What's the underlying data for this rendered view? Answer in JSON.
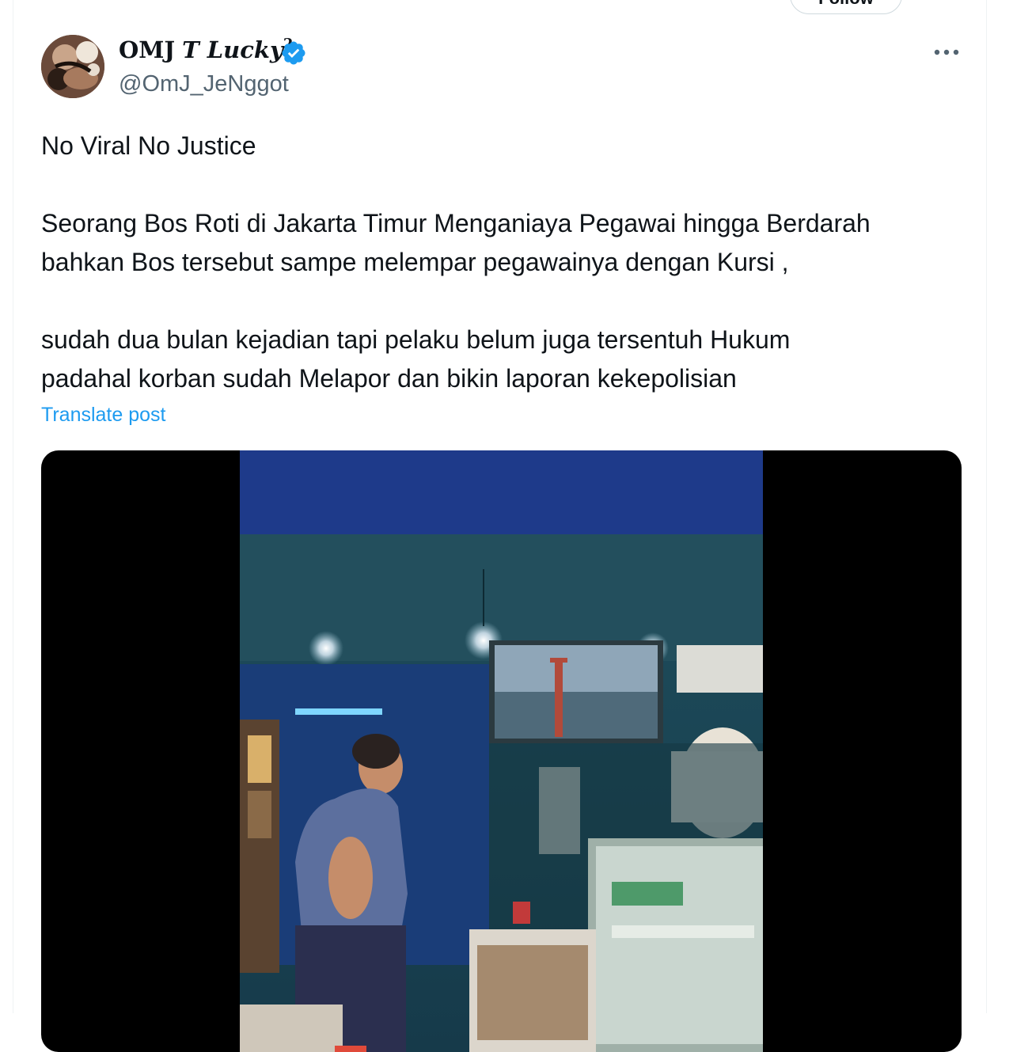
{
  "header": {
    "follow_label": "Follow",
    "more_icon": "more-horizontal-icon"
  },
  "author": {
    "display_name_prefix": "OMJ",
    "display_name_main": "T Lucky",
    "display_name_sup": "2",
    "handle": "@OmJ_JeNggot",
    "verified_color": "#1d9bf0"
  },
  "tweet": {
    "line1": "No Viral No Justice",
    "para2_line1": "Seorang Bos Roti di Jakarta Timur Menganiaya Pegawai hingga Berdarah",
    "para2_line2": "bahkan Bos tersebut sampe melempar pegawainya dengan Kursi ,",
    "para3_line1": "sudah dua bulan kejadian tapi pelaku belum juga tersentuh Hukum",
    "para3_line2": "padahal korban sudah Melapor dan bikin laporan kekepolisian",
    "translate_label": "Translate post"
  },
  "colors": {
    "accent": "#1d9bf0",
    "secondary_text": "#536471",
    "video_banner": "#1e3a8a"
  }
}
